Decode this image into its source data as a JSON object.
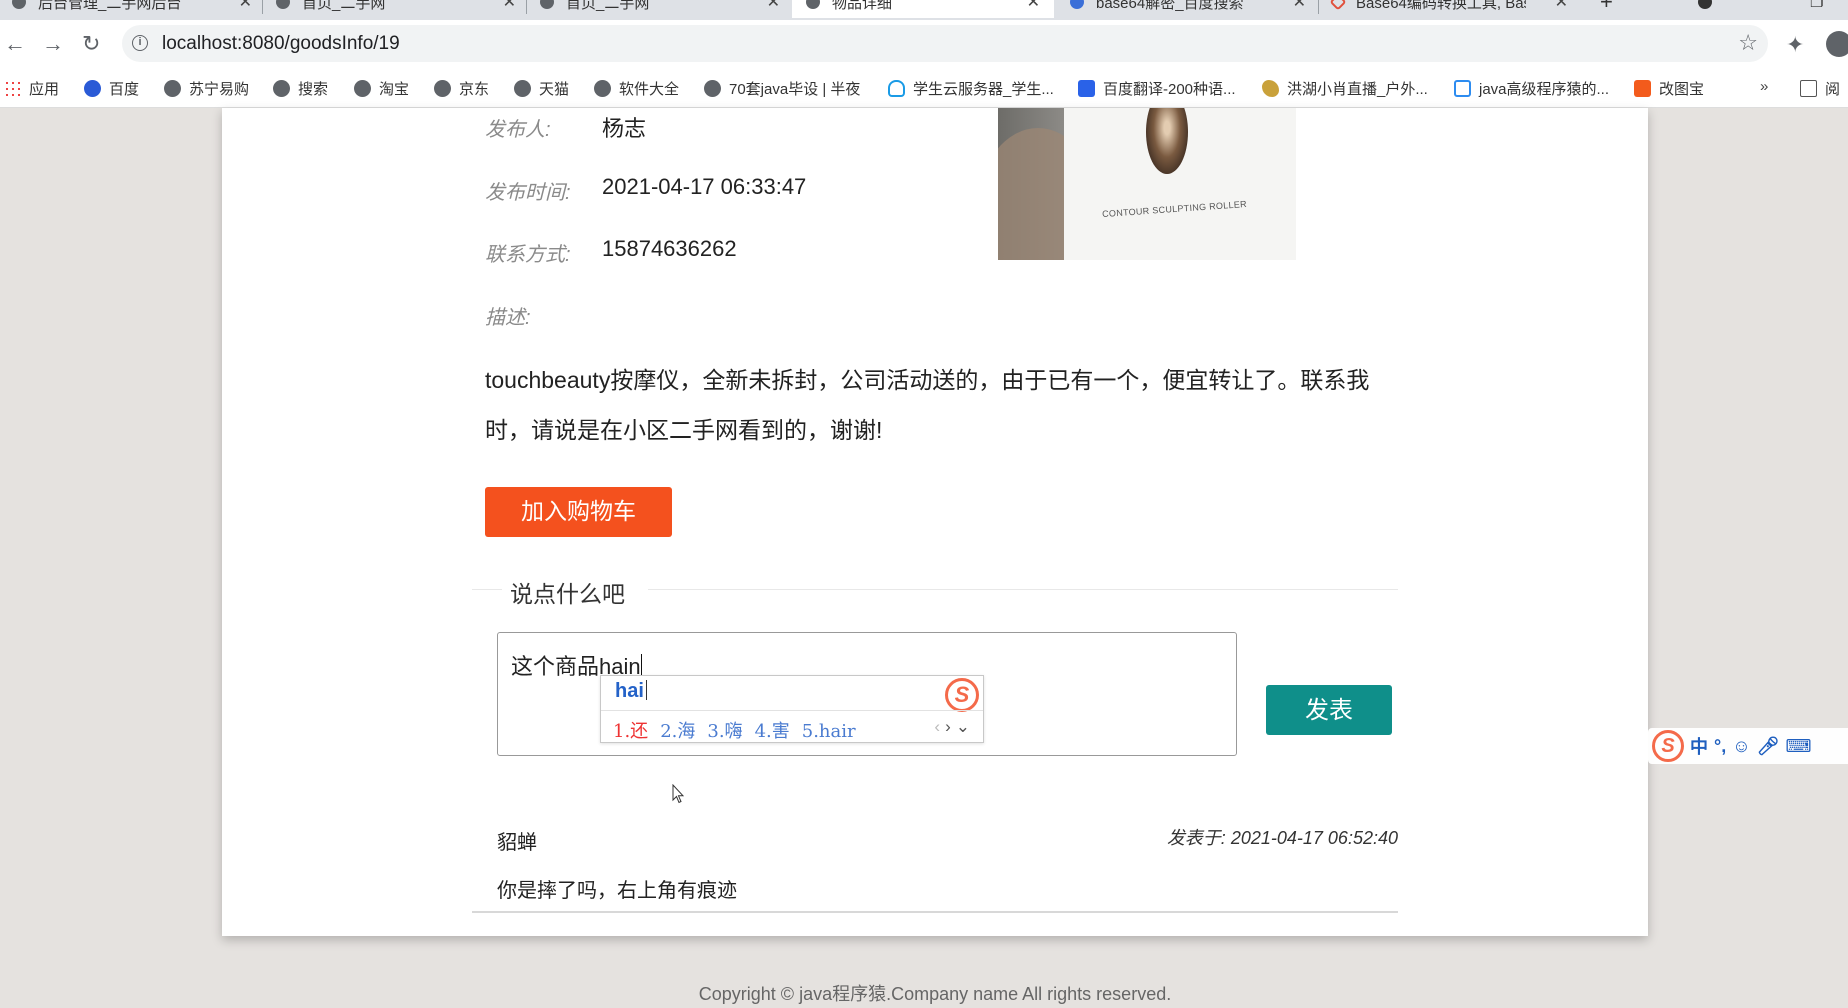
{
  "browser": {
    "tabs": [
      {
        "title": "后台管理_二手网后台"
      },
      {
        "title": "首页_二手网"
      },
      {
        "title": "首页_二手网"
      },
      {
        "title": "物品详细"
      },
      {
        "title": "base64解密_百度搜索"
      },
      {
        "title": "Base64编码转换工具, Bas"
      }
    ],
    "url": "localhost:8080/goodsInfo/19",
    "bookmarks": [
      "应用",
      "百度",
      "苏宁易购",
      "搜索",
      "淘宝",
      "京东",
      "天猫",
      "软件大全",
      "70套java毕设 | 半夜",
      "学生云服务器_学生...",
      "百度翻译-200种语...",
      "洪湖小肖直播_户外...",
      "java高级程序猿的...",
      "改图宝",
      "»",
      "阅"
    ]
  },
  "goods": {
    "publisher_label": "发布人:",
    "publisher": "杨志",
    "time_label": "发布时间:",
    "time": "2021-04-17 06:33:47",
    "contact_label": "联系方式:",
    "contact": "15874636262",
    "desc_label": "描述:",
    "description": "touchbeauty按摩仪，全新未拆封，公司活动送的，由于已有一个，便宜转让了。联系我时，请说是在小区二手网看到的，谢谢!",
    "image_brand_text": "CONTOUR SCULPTING ROLLER",
    "add_cart_label": "加入购物车"
  },
  "comment_form": {
    "legend": "说点什么吧",
    "input_text": "这个商品hain",
    "submit_label": "发表"
  },
  "ime": {
    "composition": "hai",
    "candidates": [
      "1.还",
      "2.海",
      "3.嗨",
      "4.害",
      "5.hair"
    ],
    "logo": "S",
    "toolbar_text": "中"
  },
  "comments": [
    {
      "author": "貂蝉",
      "time_label": "发表于:",
      "time": "2021-04-17 06:52:40",
      "body": "你是摔了吗，右上角有痕迹"
    }
  ],
  "footer": {
    "copyright": "Copyright © java程序猿.Company name All rights reserved."
  }
}
